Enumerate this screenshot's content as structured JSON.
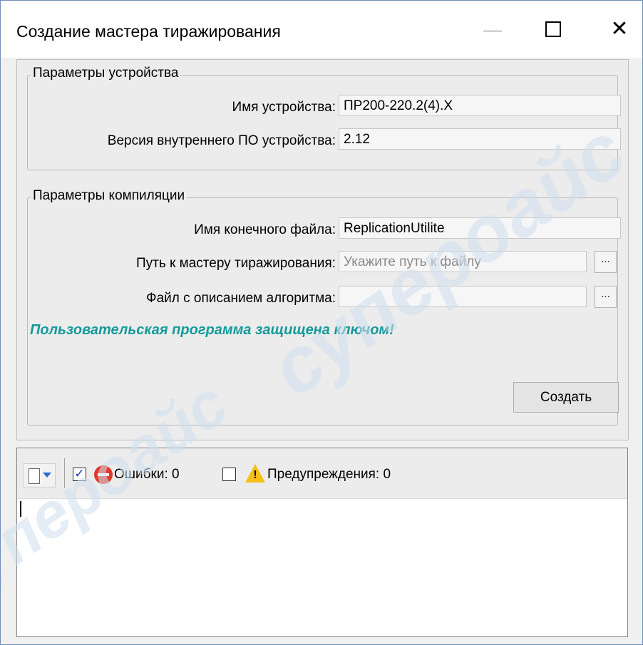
{
  "window": {
    "title": "Создание мастера тиражирования",
    "minimize_glyph": "—",
    "close_glyph": "✕"
  },
  "device_group": {
    "legend": "Параметры устройства",
    "name_label": "Имя устройства:",
    "name_value": "ПР200-220.2(4).X",
    "fw_label": "Версия внутреннего ПО устройства:",
    "fw_value": "2.12"
  },
  "compile_group": {
    "legend": "Параметры компиляции",
    "target_label": "Имя конечного файла:",
    "target_value": "ReplicationUtilite",
    "master_label": "Путь к мастеру тиражирования:",
    "master_placeholder": "Укажите путь к файлу",
    "algo_label": "Файл с описанием алгоритма:",
    "algo_value": "",
    "browse_label": "...",
    "protected_message": "Пользовательская программа защищена ключом!",
    "create_button": "Создать"
  },
  "log": {
    "errors_label": "Ошибки: 0",
    "warnings_label": "Предупреждения: 0",
    "errors_checked": true,
    "warnings_checked": false,
    "menu_icon": "document-menu-icon",
    "error_icon": "no-entry-icon",
    "warning_icon": "warning-triangle-icon"
  },
  "watermark": {
    "text": "супероайс"
  }
}
